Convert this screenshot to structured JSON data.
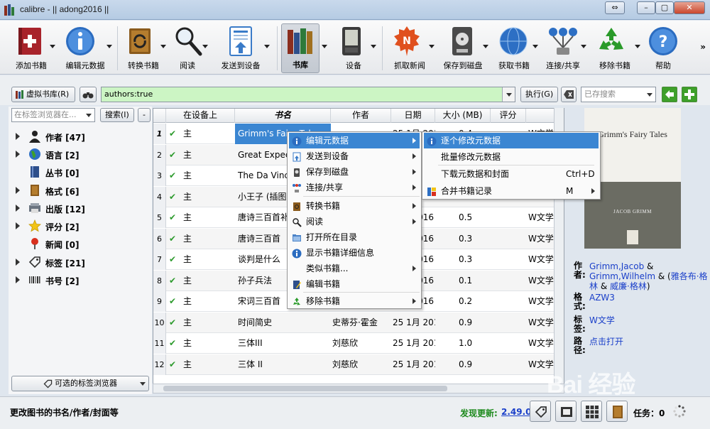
{
  "window": {
    "title": "calibre - || adong2016 ||",
    "controls": [
      "⇔",
      "–",
      "▢",
      "✕"
    ]
  },
  "toolbar": {
    "items": [
      {
        "label": "添加书籍",
        "icon": "add-book-icon"
      },
      {
        "label": "编辑元数据",
        "icon": "info-icon"
      },
      {
        "label": "转换书籍",
        "icon": "convert-icon"
      },
      {
        "label": "阅读",
        "icon": "magnifier-icon"
      },
      {
        "label": "发送到设备",
        "icon": "send-device-icon"
      },
      {
        "label": "书库",
        "icon": "library-icon"
      },
      {
        "label": "设备",
        "icon": "kindle-icon"
      },
      {
        "label": "抓取新闻",
        "icon": "news-icon"
      },
      {
        "label": "保存到磁盘",
        "icon": "disk-icon"
      },
      {
        "label": "获取书籍",
        "icon": "globe-icon"
      },
      {
        "label": "连接/共享",
        "icon": "network-icon"
      },
      {
        "label": "移除书籍",
        "icon": "recycle-icon"
      },
      {
        "label": "帮助",
        "icon": "help-icon"
      }
    ],
    "more": "»"
  },
  "searchbar": {
    "virtual_library": "虚拟书库(R)",
    "query": "authors:true",
    "execute": "执行(G)",
    "saved_search_placeholder": "已存搜索",
    "clear_icon": "clear-icon"
  },
  "tagbrowser": {
    "filter_placeholder": "在标签浏览器在...",
    "find_button": "搜索(I)",
    "collapse_button": "-",
    "items": [
      {
        "label": "作者 [47]",
        "icon": "person-icon",
        "expandable": true
      },
      {
        "label": "语言 [2]",
        "icon": "languages-icon",
        "expandable": true
      },
      {
        "label": "丛书 [0]",
        "icon": "series-icon",
        "expandable": false
      },
      {
        "label": "格式 [6]",
        "icon": "format-icon",
        "expandable": true
      },
      {
        "label": "出版 [12]",
        "icon": "publisher-icon",
        "expandable": true
      },
      {
        "label": "评分 [2]",
        "icon": "star-icon",
        "expandable": true
      },
      {
        "label": "新闻 [0]",
        "icon": "news-pin-icon",
        "expandable": false
      },
      {
        "label": "标签 [21]",
        "icon": "tag-icon",
        "expandable": true
      },
      {
        "label": "书号 [2]",
        "icon": "barcode-icon",
        "expandable": true
      }
    ],
    "configure_button": "可选的标签浏览器"
  },
  "booklist": {
    "columns": [
      "在设备上",
      "书名",
      "作者",
      "日期",
      "大小 (MB)",
      "评分"
    ],
    "rows": [
      {
        "num": "1",
        "device": "主",
        "title": "Grimm's Fairy Tales",
        "author": "",
        "date": "25 1月 2016",
        "size": "0.4",
        "tags": "W文学",
        "selected": true
      },
      {
        "num": "2",
        "device": "主",
        "title": "Great Expectations",
        "author": "",
        "date": "",
        "size": "",
        "tags": ""
      },
      {
        "num": "3",
        "device": "主",
        "title": "The Da Vinci Code",
        "author": "",
        "date": "",
        "size": "",
        "tags": ""
      },
      {
        "num": "4",
        "device": "主",
        "title": "小王子 (插图版)",
        "author": "",
        "date": "",
        "size": "",
        "tags": ""
      },
      {
        "num": "5",
        "device": "主",
        "title": "唐诗三百首补",
        "author": "",
        "date": "2016",
        "size": "0.5",
        "tags": "W文学"
      },
      {
        "num": "6",
        "device": "主",
        "title": "唐诗三百首",
        "author": "",
        "date": "2016",
        "size": "0.3",
        "tags": "W文学"
      },
      {
        "num": "7",
        "device": "主",
        "title": "谈判是什么",
        "author": "",
        "date": "2016",
        "size": "0.3",
        "tags": "W文学"
      },
      {
        "num": "8",
        "device": "主",
        "title": "孙子兵法",
        "author": "",
        "date": "2016",
        "size": "0.1",
        "tags": "W文学"
      },
      {
        "num": "9",
        "device": "主",
        "title": "宋词三百首",
        "author": "",
        "date": "2016",
        "size": "0.2",
        "tags": "W文学"
      },
      {
        "num": "10",
        "device": "主",
        "title": "时间简史",
        "author": "史蒂芬·霍金",
        "date": "25 1月 2016",
        "size": "0.9",
        "tags": "W文学"
      },
      {
        "num": "11",
        "device": "主",
        "title": "三体III",
        "author": "刘慈欣",
        "date": "25 1月 2016",
        "size": "1.0",
        "tags": "W文学"
      },
      {
        "num": "12",
        "device": "主",
        "title": "三体 II",
        "author": "刘慈欣",
        "date": "25 1月 2016",
        "size": "0.9",
        "tags": "W文学"
      }
    ]
  },
  "context_menu": {
    "items": [
      {
        "label": "编辑元数据",
        "icon": "info-icon",
        "submenu": true,
        "highlight": true
      },
      {
        "label": "发送到设备",
        "icon": "send-device-icon",
        "submenu": true
      },
      {
        "label": "保存到磁盘",
        "icon": "disk-icon",
        "submenu": true
      },
      {
        "label": "连接/共享",
        "icon": "network-icon",
        "submenu": true
      },
      {
        "label": "转换书籍",
        "icon": "convert-icon",
        "submenu": true
      },
      {
        "label": "阅读",
        "icon": "magnifier-icon",
        "submenu": true
      },
      {
        "label": "打开所在目录",
        "icon": "folder-icon",
        "submenu": false
      },
      {
        "label": "显示书籍详细信息",
        "icon": "info-icon",
        "submenu": false
      },
      {
        "label": "类似书籍...",
        "icon": "",
        "submenu": true
      },
      {
        "label": "编辑书籍",
        "icon": "edit-book-icon",
        "submenu": false
      },
      {
        "label": "移除书籍",
        "icon": "recycle-icon",
        "submenu": true
      }
    ]
  },
  "submenu": {
    "items": [
      {
        "label": "逐个修改元数据",
        "icon": "info-icon",
        "shortcut": "",
        "highlight": true
      },
      {
        "label": "批量修改元数据",
        "icon": "",
        "shortcut": ""
      },
      {
        "label": "下载元数据和封面",
        "icon": "",
        "shortcut": "Ctrl+D"
      },
      {
        "label": "合并书籍记录",
        "icon": "merge-icon",
        "shortcut": "M",
        "submenu": true
      }
    ]
  },
  "details": {
    "cover_title": "Grimm's Fairy Tales",
    "cover_author": "JACOB GRIMM",
    "authors_label": "作者:",
    "authors_line1": "Grimm,Jacob",
    "authors_amp1": " &",
    "authors_line2": "Grimm,Wilhelm",
    "authors_amp2": " & (",
    "authors_cn1": "雅各布·格林",
    "authors_amp3": " & ",
    "authors_cn2": "威廉·格林",
    "authors_close": ")",
    "format_label": "格式:",
    "format_value": "AZW3",
    "tags_label": "标签:",
    "tags_value": "W文学",
    "path_label": "路径:",
    "path_value": "点击打开"
  },
  "statusbar": {
    "message": "更改图书的书名/作者/封面等",
    "update_label": "发现更新:",
    "update_version": "2.49.0",
    "jobs": "任务：0"
  },
  "watermark": "Bai 经验"
}
